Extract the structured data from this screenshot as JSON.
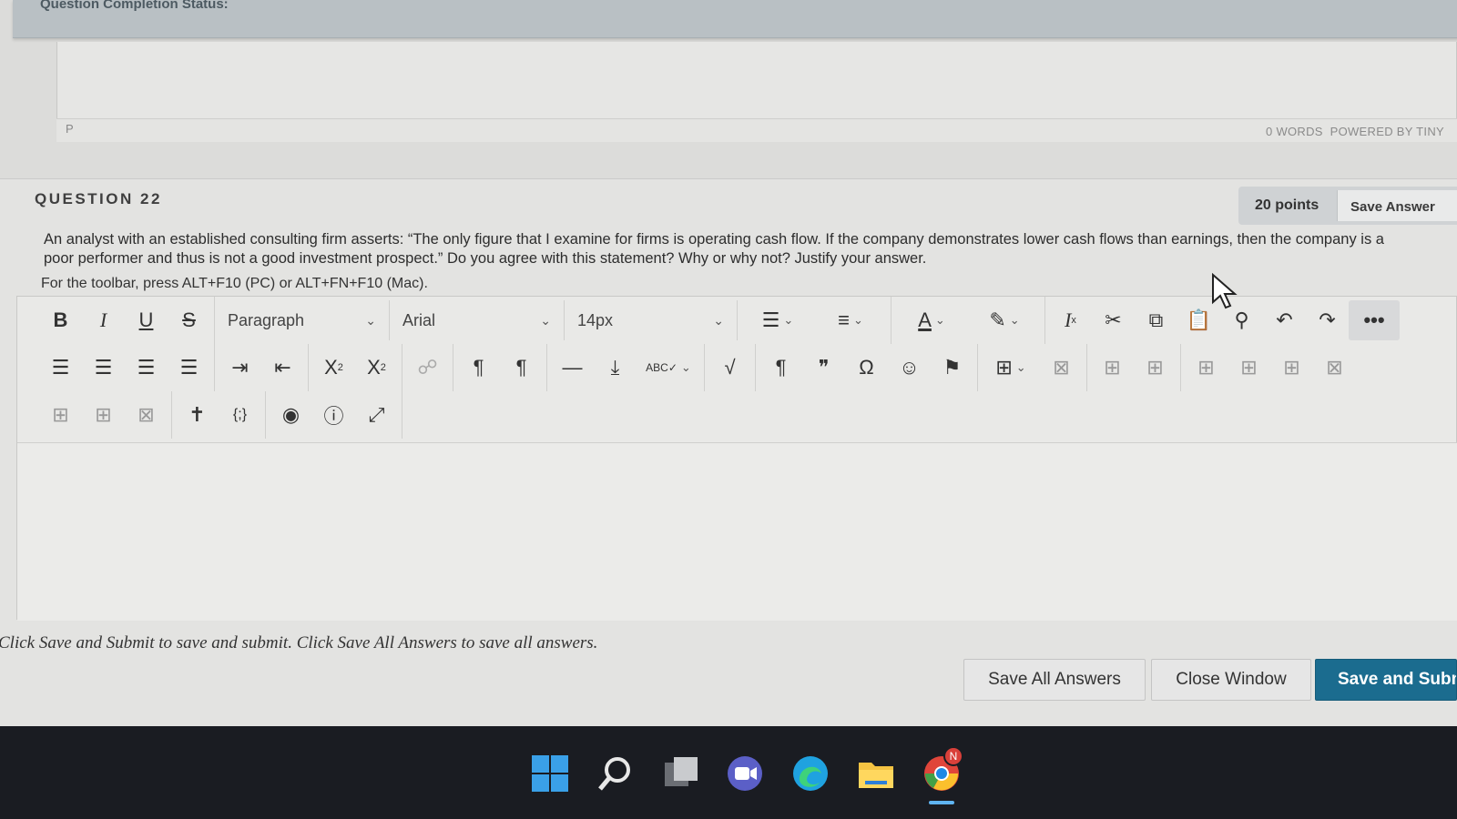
{
  "status_strip": {
    "text": "Question Completion Status:"
  },
  "previous_editor": {
    "path": "P",
    "word_count": "0 WORDS",
    "powered_by": "POWERED BY TINY"
  },
  "question": {
    "title": "QUESTION 22",
    "points": "20 points",
    "save_answer": "Save Answer",
    "text": "An analyst with an established consulting firm asserts: “The only figure that I examine for firms is operating cash flow.  If the company demonstrates lower cash flows than earnings, then the company is a poor performer and thus is not a good investment prospect.”  Do you agree with this statement? Why or why not?  Justify your answer.",
    "toolbar_hint": "For the toolbar, press ALT+F10 (PC) or ALT+FN+F10 (Mac)."
  },
  "toolbar": {
    "block_format": "Paragraph",
    "font_family": "Arial",
    "font_size": "14px",
    "more_label": "•••"
  },
  "footer": {
    "note": "Click Save and Submit to save and submit. Click Save All Answers to save all answers.",
    "save_all": "Save All Answers",
    "close_window": "Close Window",
    "save_submit": "Save and Submit"
  },
  "taskbar": {
    "chrome_badge": "N"
  },
  "colors": {
    "primary_button": "#1b6c8f",
    "taskbar": "#1a1c22"
  }
}
